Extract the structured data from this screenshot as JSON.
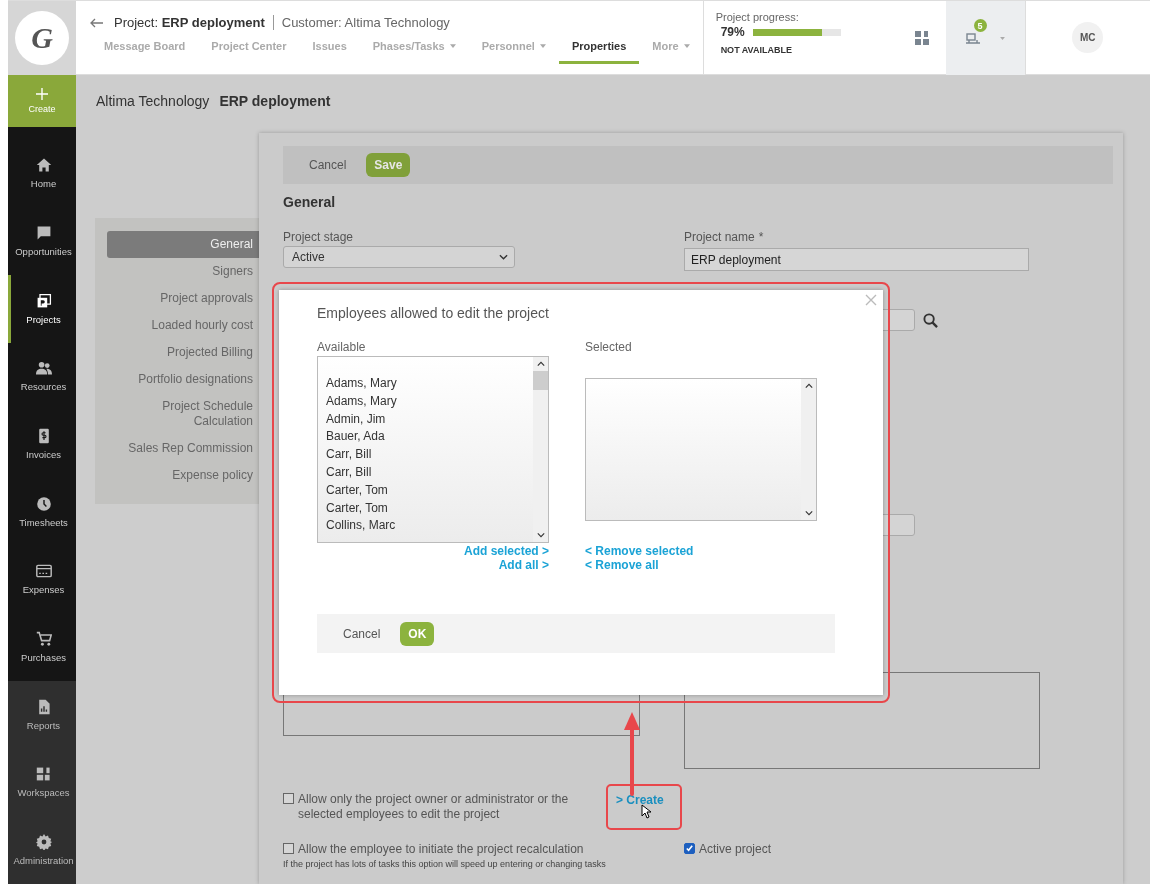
{
  "logo": {
    "letter": "G"
  },
  "create_button": {
    "label": "Create"
  },
  "nav_rail": {
    "main": [
      {
        "kind": "home",
        "label": "Home",
        "selected": false
      },
      {
        "kind": "chat",
        "label": "Opportunities",
        "selected": false
      },
      {
        "kind": "projects",
        "label": "Projects",
        "selected": true
      },
      {
        "kind": "people",
        "label": "Resources",
        "selected": false
      },
      {
        "kind": "invoice",
        "label": "Invoices",
        "selected": false
      },
      {
        "kind": "clock",
        "label": "Timesheets",
        "selected": false
      },
      {
        "kind": "card",
        "label": "Expenses",
        "selected": false
      },
      {
        "kind": "cart",
        "label": "Purchases",
        "selected": false
      }
    ],
    "admin": [
      {
        "kind": "report",
        "label": "Reports",
        "selected": false
      },
      {
        "kind": "tiles",
        "label": "Workspaces",
        "selected": false
      },
      {
        "kind": "gear",
        "label": "Administration",
        "selected": false
      }
    ]
  },
  "header": {
    "project": "Project: **ERP deployment**",
    "customer": "Customer: Altima Technology",
    "tabs": [
      {
        "label": "Message Board",
        "selected": false,
        "dropdown": false
      },
      {
        "label": "Project Center",
        "selected": false,
        "dropdown": false
      },
      {
        "label": "Issues",
        "selected": false,
        "dropdown": false
      },
      {
        "label": "Phases/Tasks",
        "selected": false,
        "dropdown": true
      },
      {
        "label": "Personnel",
        "selected": false,
        "dropdown": true
      },
      {
        "label": "Properties",
        "selected": true,
        "dropdown": false
      },
      {
        "label": "More",
        "selected": false,
        "dropdown": true
      }
    ]
  },
  "progress": {
    "label": "Project progress:",
    "percent": "79%",
    "level": 0.79,
    "status": "NOT AVAILABLE"
  },
  "notifications": {
    "count": "5"
  },
  "user": {
    "initials": "MC"
  },
  "breadcrumb": {
    "customer": "Altima Technology",
    "project": "ERP deployment"
  },
  "settings_nav": [
    {
      "label": "General",
      "selected": true
    },
    {
      "label": "Signers",
      "selected": false
    },
    {
      "label": "Project approvals",
      "selected": false
    },
    {
      "label": "Loaded hourly cost",
      "selected": false
    },
    {
      "label": "Projected Billing",
      "selected": false
    },
    {
      "label": "Portfolio designations",
      "selected": false
    },
    {
      "label": "Project Schedule Calculation",
      "selected": false
    },
    {
      "label": "Sales Rep Commission",
      "selected": false
    },
    {
      "label": "Expense policy",
      "selected": false
    }
  ],
  "toolbar": {
    "cancel": "Cancel",
    "save": "Save"
  },
  "section_title": "General",
  "project_stage": {
    "label": "Project stage",
    "value": "Active"
  },
  "project_name": {
    "label": "Project name",
    "required_mark": "*",
    "value": "ERP deployment"
  },
  "options": [
    {
      "label": "Allow only the project owner or administrator or the selected employees to edit the project",
      "checked": false,
      "link": "> Create"
    },
    {
      "label": "Allow the employee to initiate the project recalculation",
      "checked": false,
      "note": "If the project has lots of tasks this option will speed up entering or changing tasks"
    },
    {
      "label": "Active project",
      "checked": true
    }
  ],
  "dialog": {
    "title": "Employees allowed to edit the project",
    "available_label": "Available",
    "selected_label": "Selected",
    "available": [
      "Adams, Mary",
      "Adams, Mary",
      "Admin, Jim",
      "Bauer, Ada",
      "Carr, Bill",
      "Carr, Bill",
      "Carter, Tom",
      "Carter, Tom",
      "Collins, Marc"
    ],
    "add_selected": "Add selected >",
    "add_all": "Add all >",
    "remove_selected": "< Remove selected",
    "remove_all": "< Remove all",
    "cancel": "Cancel",
    "ok": "OK"
  }
}
